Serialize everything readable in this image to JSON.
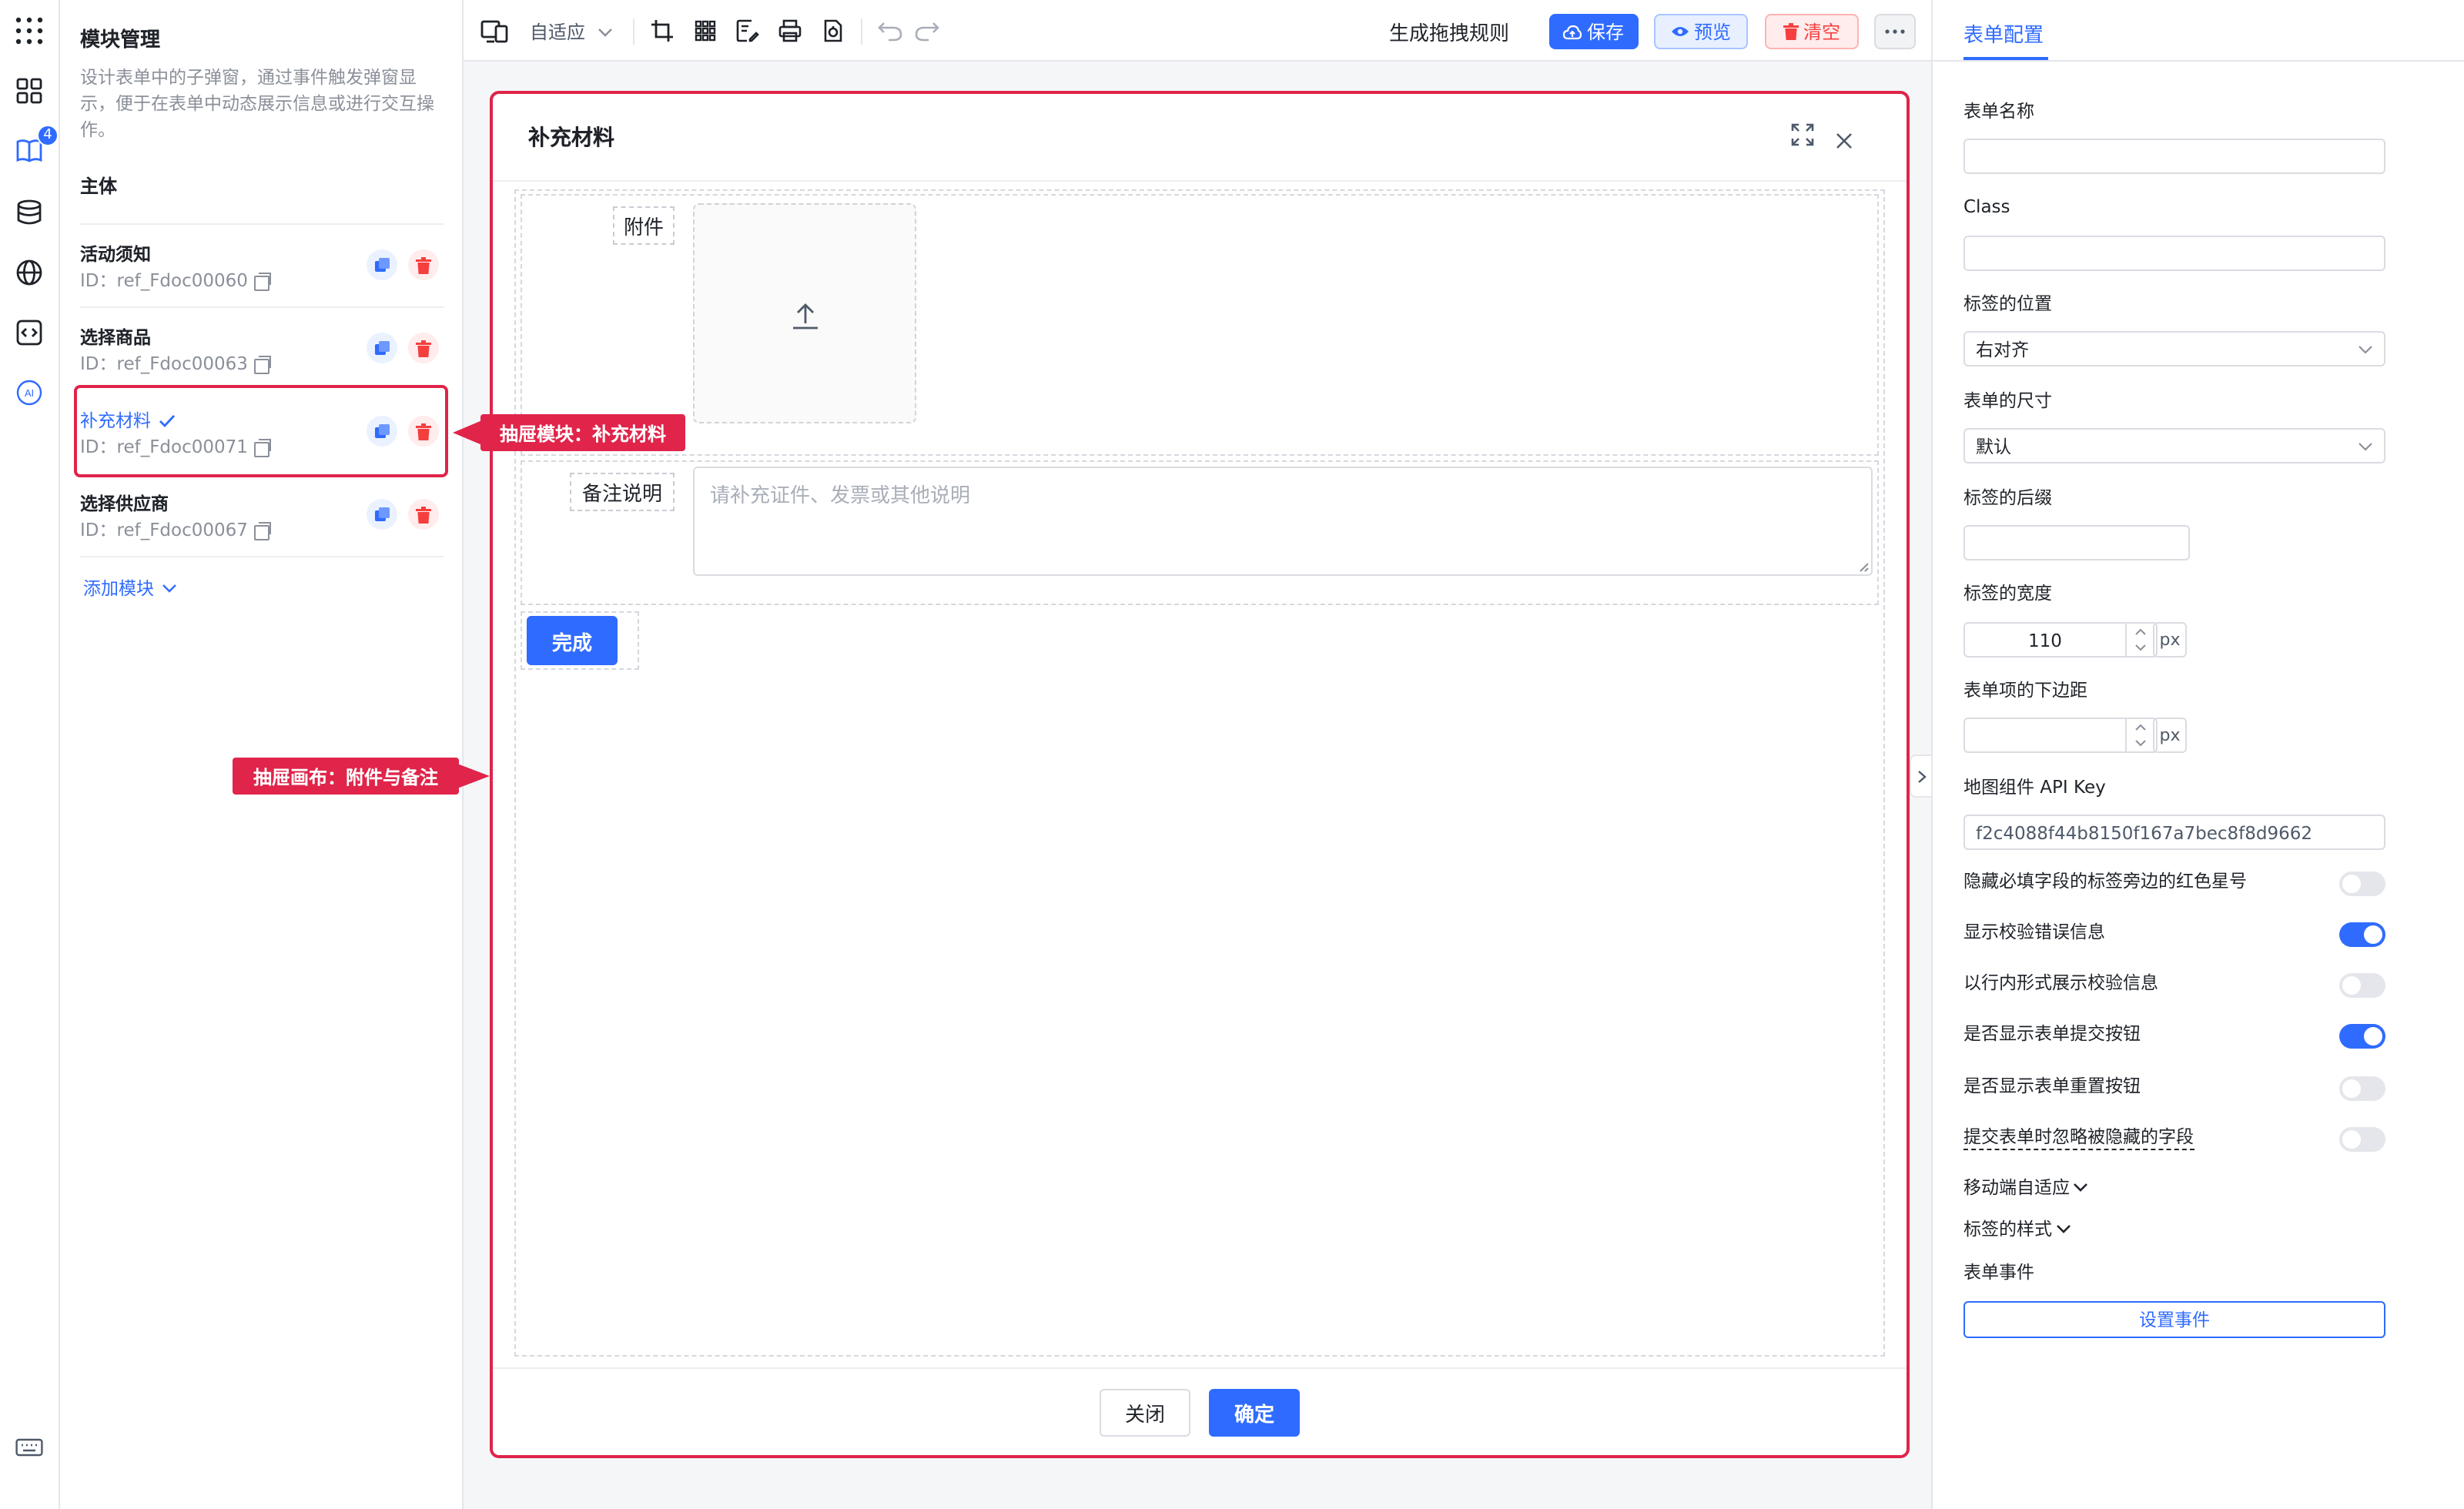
{
  "modules": {
    "title": "模块管理",
    "description": "设计表单中的子弹窗，通过事件触发弹窗显示，便于在表单中动态展示信息或进行交互操作。",
    "section": "主体",
    "items": [
      {
        "name": "活动须知",
        "id": "ID：ref_Fdoc00060"
      },
      {
        "name": "选择商品",
        "id": "ID：ref_Fdoc00063"
      },
      {
        "name": "补充材料",
        "id": "ID：ref_Fdoc00071"
      },
      {
        "name": "选择供应商",
        "id": "ID：ref_Fdoc00067"
      }
    ],
    "add_label": "添加模块"
  },
  "rail": {
    "badge": "4",
    "ai_label": "AI"
  },
  "toolbar": {
    "device_mode": "自适应",
    "generate_label": "生成拖拽规则",
    "save_label": "保存",
    "preview_label": "预览",
    "clear_label": "清空"
  },
  "annotations": {
    "module_callout": "抽屉模块：补充材料",
    "canvas_callout": "抽屉画布：附件与备注"
  },
  "modal": {
    "title": "补充材料",
    "attachment_label": "附件",
    "remark_label": "备注说明",
    "remark_placeholder": "请补充证件、发票或其他说明",
    "done_label": "完成",
    "close_label": "关闭",
    "confirm_label": "确定"
  },
  "config": {
    "tab": "表单配置",
    "form_name_label": "表单名称",
    "form_name_value": "",
    "class_label": "Class",
    "class_value": "",
    "label_position_label": "标签的位置",
    "label_position_value": "右对齐",
    "form_size_label": "表单的尺寸",
    "form_size_value": "默认",
    "label_suffix_label": "标签的后缀",
    "label_width_label": "标签的宽度",
    "label_width_value": "110",
    "unit": "px",
    "item_margin_label": "表单项的下边距",
    "map_key_label": "地图组件 API Key",
    "map_key_value": "f2c4088f44b8150f167a7bec8f8d9662",
    "switches": [
      {
        "label": "隐藏必填字段的标签旁边的红色星号",
        "on": false
      },
      {
        "label": "显示校验错误信息",
        "on": true
      },
      {
        "label": "以行内形式展示校验信息",
        "on": false
      },
      {
        "label": "是否显示表单提交按钮",
        "on": true
      },
      {
        "label": "是否显示表单重置按钮",
        "on": false
      },
      {
        "label": "提交表单时忽略被隐藏的字段",
        "on": false
      }
    ],
    "mobile_label": "移动端自适应",
    "label_style_label": "标签的样式",
    "events_label": "表单事件",
    "events_button": "设置事件"
  },
  "colors": {
    "accent": "#2f6bff",
    "danger": "#e0244a",
    "delete": "#f53f3f"
  }
}
